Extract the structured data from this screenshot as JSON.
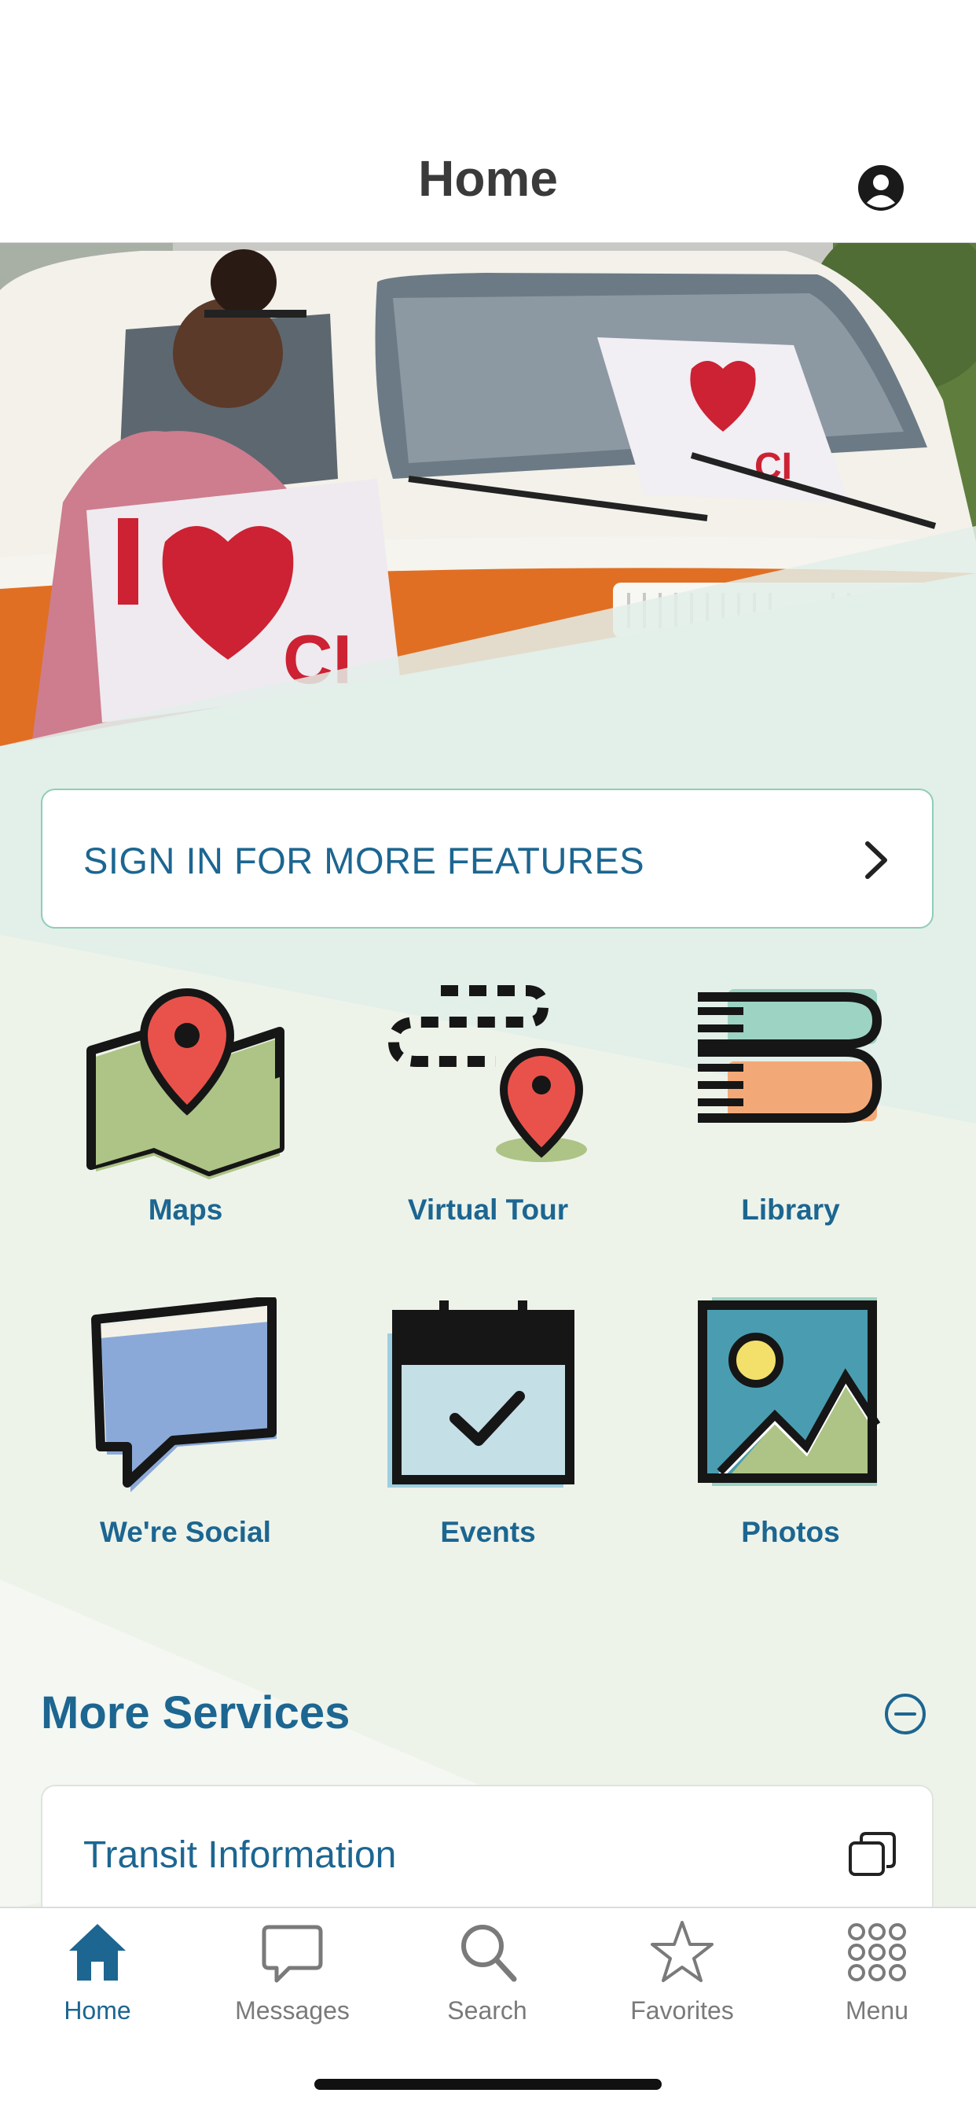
{
  "header": {
    "title": "Home",
    "profile_icon": "account-circle-icon"
  },
  "hero": {
    "description": "",
    "sign_text_left": "CI",
    "sign_text_right": "CI"
  },
  "signin": {
    "label": "SIGN IN FOR MORE FEATURES",
    "icon": "chevron-right-icon"
  },
  "tiles": [
    {
      "label": "Maps",
      "icon": "map-icon"
    },
    {
      "label": "Virtual Tour",
      "icon": "tour-route-icon"
    },
    {
      "label": "Library",
      "icon": "books-icon"
    },
    {
      "label": "We're Social",
      "icon": "speech-bubble-icon"
    },
    {
      "label": "Events",
      "icon": "calendar-check-icon"
    },
    {
      "label": "Photos",
      "icon": "photo-landscape-icon"
    }
  ],
  "more_services": {
    "title": "More Services",
    "collapse_icon": "minus-circle-icon",
    "items": [
      {
        "label": "Transit Information",
        "icon": "external-window-icon"
      }
    ]
  },
  "tabbar": {
    "items": [
      {
        "label": "Home",
        "icon": "home-icon",
        "active": true
      },
      {
        "label": "Messages",
        "icon": "chat-bubble-icon",
        "active": false
      },
      {
        "label": "Search",
        "icon": "search-icon",
        "active": false
      },
      {
        "label": "Favorites",
        "icon": "star-icon",
        "active": false
      },
      {
        "label": "Menu",
        "icon": "grid-dots-icon",
        "active": false
      }
    ]
  },
  "colors": {
    "brand_blue": "#1c6691",
    "accent_teal": "#8fcdb8",
    "background": "#eef3ea"
  }
}
